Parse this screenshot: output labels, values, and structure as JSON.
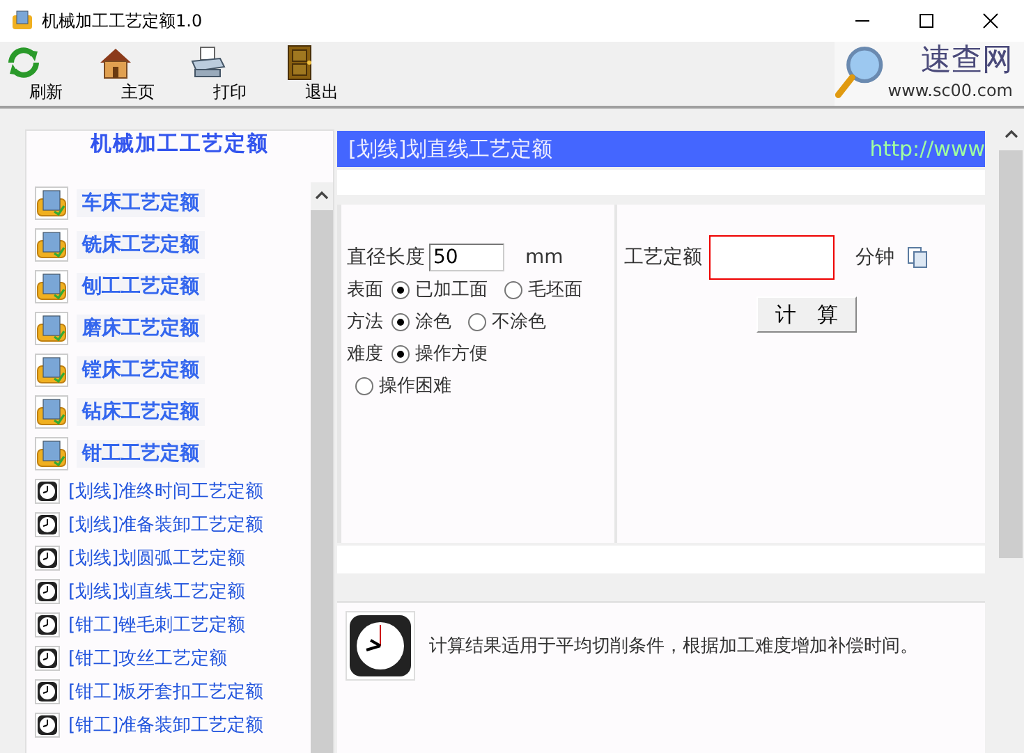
{
  "window": {
    "title": "机械加工工艺定额1.0"
  },
  "toolbar": [
    {
      "label": "刷新",
      "kind": "refresh"
    },
    {
      "label": "主页",
      "kind": "home"
    },
    {
      "label": "打印",
      "kind": "print"
    },
    {
      "label": "退出",
      "kind": "exit"
    }
  ],
  "logo": {
    "name": "速查网",
    "url": "www.sc00.com"
  },
  "sidebar": {
    "title": "机械加工工艺定额",
    "items": [
      {
        "label": "车床工艺定额",
        "kind": "calculator"
      },
      {
        "label": "铣床工艺定额",
        "kind": "calculator"
      },
      {
        "label": "刨工工艺定额",
        "kind": "calculator"
      },
      {
        "label": "磨床工艺定额",
        "kind": "calculator"
      },
      {
        "label": "镗床工艺定额",
        "kind": "calculator"
      },
      {
        "label": "钻床工艺定额",
        "kind": "calculator"
      },
      {
        "label": "钳工工艺定额",
        "kind": "calculator"
      },
      {
        "label": "[划线]准终时间工艺定额",
        "kind": "clock"
      },
      {
        "label": "[划线]准备装卸工艺定额",
        "kind": "clock"
      },
      {
        "label": "[划线]划圆弧工艺定额",
        "kind": "clock"
      },
      {
        "label": "[划线]划直线工艺定额",
        "kind": "clock"
      },
      {
        "label": "[钳工]锉毛刺工艺定额",
        "kind": "clock"
      },
      {
        "label": "[钳工]攻丝工艺定额",
        "kind": "clock"
      },
      {
        "label": "[钳工]板牙套扣工艺定额",
        "kind": "clock"
      },
      {
        "label": "[钳工]准备装卸工艺定额",
        "kind": "clock"
      }
    ]
  },
  "content": {
    "header": {
      "title": "[划线]划直线工艺定额",
      "link": "http://www"
    },
    "length": {
      "label": "直径长度",
      "value": "50",
      "unit": "mm"
    },
    "options": [
      {
        "label": "表面",
        "choices": [
          {
            "label": "已加工面",
            "selected": true
          },
          {
            "label": "毛坯面",
            "selected": false
          }
        ]
      },
      {
        "label": "方法",
        "choices": [
          {
            "label": "涂色",
            "selected": true
          },
          {
            "label": "不涂色",
            "selected": false
          }
        ]
      },
      {
        "label": "难度",
        "choices": [
          {
            "label": "操作方便",
            "selected": true
          },
          {
            "label": "操作困难",
            "selected": false
          }
        ]
      }
    ],
    "result": {
      "label": "工艺定额",
      "unit": "分钟"
    },
    "button": "计　算",
    "note": "计算结果适用于平均切削条件，根据加工难度增加补偿时间。"
  }
}
